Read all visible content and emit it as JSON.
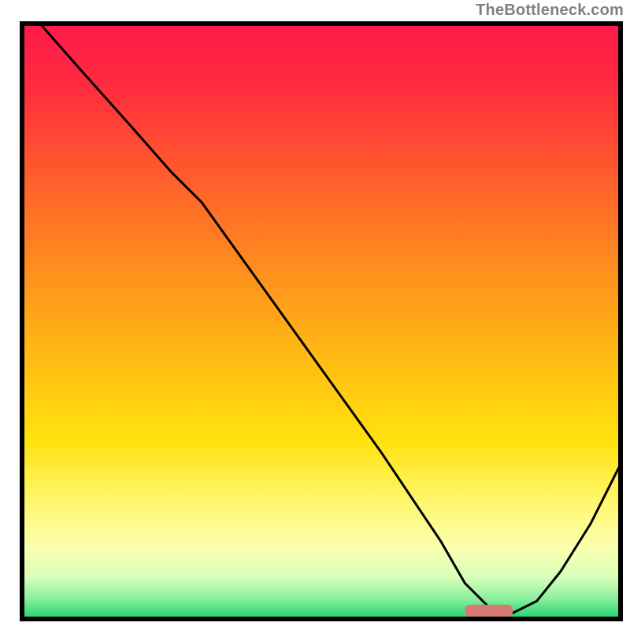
{
  "watermark": "TheBottleneck.com",
  "chart_data": {
    "type": "line",
    "title": "",
    "xlabel": "",
    "ylabel": "",
    "xlim": [
      0,
      100
    ],
    "ylim": [
      0,
      100
    ],
    "grid": false,
    "description": "Single black curve overlaid on a vertical rainbow gradient (red at top through yellow to green at bottom). The curve falls from the top-left, reaches a minimum near x≈78, then rises toward the right edge. A small salmon-colored rounded marker sits at the curve's minimum on the bottom axis.",
    "series": [
      {
        "name": "curve",
        "color": "#000000",
        "x": [
          3,
          10,
          18,
          25,
          30,
          40,
          50,
          60,
          70,
          74,
          78,
          82,
          86,
          90,
          95,
          100
        ],
        "y": [
          100,
          92,
          83,
          75,
          70,
          56,
          42,
          28,
          13,
          6,
          2,
          1,
          3,
          8,
          16,
          26
        ]
      }
    ],
    "marker": {
      "name": "optimum",
      "color": "#d67a74",
      "x": 78,
      "width_pct": 8,
      "height_pct": 2
    },
    "gradient_stops": [
      {
        "offset": 0.0,
        "color": "#ff1a4b"
      },
      {
        "offset": 0.1,
        "color": "#ff2a3f"
      },
      {
        "offset": 0.25,
        "color": "#ff5a2c"
      },
      {
        "offset": 0.4,
        "color": "#ff8a1f"
      },
      {
        "offset": 0.55,
        "color": "#ffb814"
      },
      {
        "offset": 0.7,
        "color": "#ffe20e"
      },
      {
        "offset": 0.8,
        "color": "#fff66a"
      },
      {
        "offset": 0.88,
        "color": "#faffb0"
      },
      {
        "offset": 0.93,
        "color": "#d8ffb8"
      },
      {
        "offset": 0.965,
        "color": "#8cf0a0"
      },
      {
        "offset": 1.0,
        "color": "#1fd36a"
      }
    ],
    "frame_color": "#000000"
  }
}
